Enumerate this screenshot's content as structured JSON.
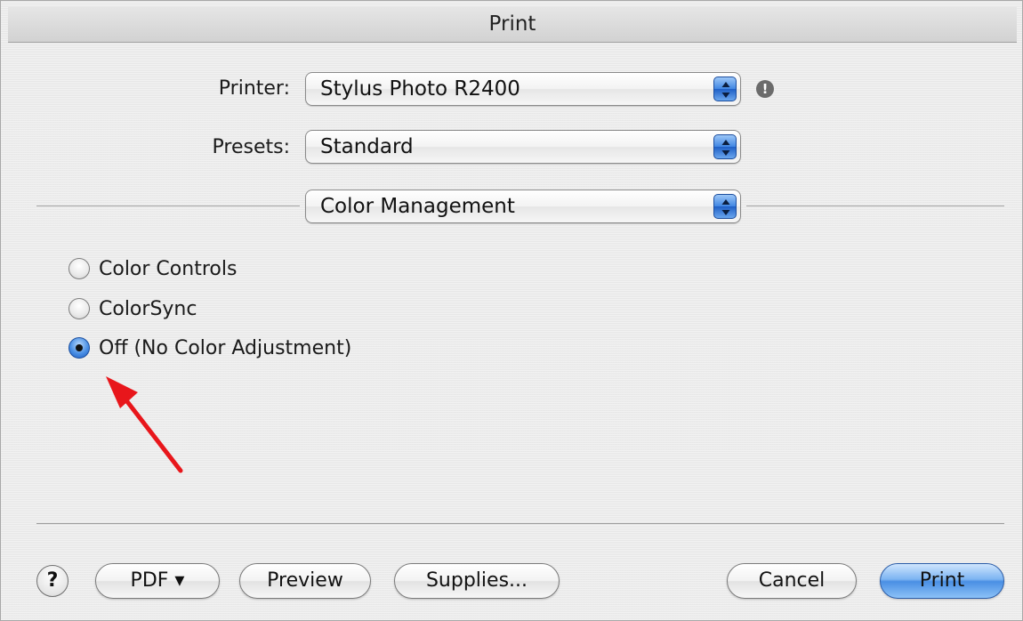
{
  "window": {
    "title": "Print"
  },
  "printer": {
    "label": "Printer:",
    "value": "Stylus Photo R2400"
  },
  "presets": {
    "label": "Presets:",
    "value": "Standard"
  },
  "panel": {
    "value": "Color Management"
  },
  "color_options": [
    {
      "label": "Color Controls",
      "selected": false
    },
    {
      "label": "ColorSync",
      "selected": false
    },
    {
      "label": "Off (No Color Adjustment)",
      "selected": true
    }
  ],
  "buttons": {
    "help": "?",
    "pdf": "PDF ▾",
    "preview": "Preview",
    "supplies": "Supplies...",
    "cancel": "Cancel",
    "print": "Print"
  },
  "alert": {
    "glyph": "!"
  },
  "colors": {
    "accent": "#4a8fe4",
    "annotation_arrow": "#e8161b"
  }
}
